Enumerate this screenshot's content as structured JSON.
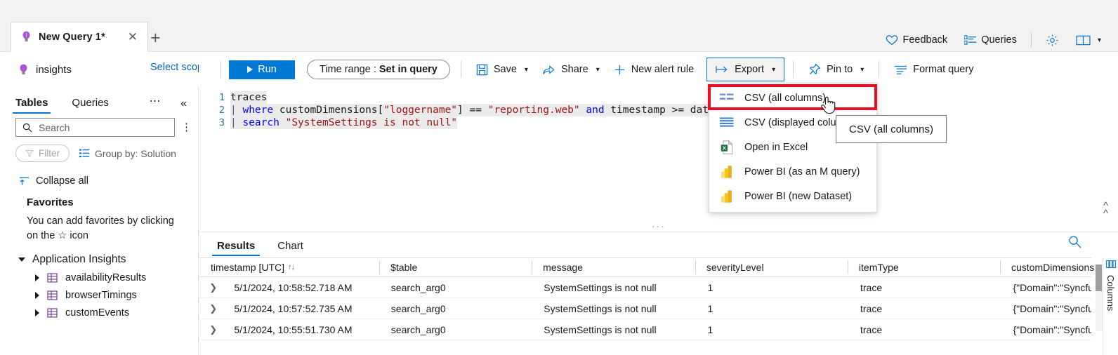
{
  "tab": {
    "label": "New Query 1*",
    "close_icon": "close-icon",
    "bulb_icon": "lightbulb-icon",
    "add_icon": "plus-icon"
  },
  "header_right": {
    "feedback": "Feedback",
    "queries": "Queries",
    "settings_icon": "gear-icon",
    "book_icon": "book-icon",
    "chevron_icon": "chevron-down-icon"
  },
  "scope": {
    "name": "insights",
    "select_link": "Select scope"
  },
  "toolbar": {
    "run": "Run",
    "time_range_label": "Time range :",
    "time_range_value": "Set in query",
    "save": "Save",
    "share": "Share",
    "new_alert_rule": "New alert rule",
    "export": "Export",
    "pin_to": "Pin to",
    "format_query": "Format query"
  },
  "export_menu": {
    "items": [
      {
        "label": "CSV (all columns)",
        "icon": "csv-all-columns-icon"
      },
      {
        "label": "CSV (displayed columns)",
        "icon": "csv-displayed-columns-icon"
      },
      {
        "label": "Open in Excel",
        "icon": "excel-icon"
      },
      {
        "label": "Power BI (as an M query)",
        "icon": "power-bi-icon"
      },
      {
        "label": "Power BI (new Dataset)",
        "icon": "power-bi-icon"
      }
    ],
    "tooltip": "CSV (all columns)",
    "highlight_color": "#e81123"
  },
  "sidebar": {
    "tabs": [
      {
        "label": "Tables",
        "active": true
      },
      {
        "label": "Queries",
        "active": false
      }
    ],
    "more_icon": "ellipsis-icon",
    "collapse_icon": "double-chevron-left-icon",
    "search_placeholder": "Search",
    "filter_label": "Filter",
    "group_by": "Group by: Solution",
    "collapse_all": "Collapse all",
    "favorites_title": "Favorites",
    "favorites_text": "You can add favorites by clicking on the ☆ icon",
    "group_title": "Application Insights",
    "tables": [
      "availabilityResults",
      "browserTimings",
      "customEvents"
    ]
  },
  "editor": {
    "lines": [
      {
        "num": "1",
        "parts": [
          {
            "t": "traces",
            "c": "op"
          }
        ]
      },
      {
        "num": "2",
        "parts": [
          {
            "t": "| ",
            "c": "pipe"
          },
          {
            "t": "where",
            "c": "kw"
          },
          {
            "t": " customDimensions[",
            "c": "op"
          },
          {
            "t": "\"loggername\"",
            "c": "str"
          },
          {
            "t": "] == ",
            "c": "op"
          },
          {
            "t": "\"reporting.web\"",
            "c": "str"
          },
          {
            "t": " ",
            "c": "op"
          },
          {
            "t": "and",
            "c": "kw"
          },
          {
            "t": " timestamp >= dat",
            "c": "op"
          }
        ]
      },
      {
        "num": "3",
        "parts": [
          {
            "t": "| ",
            "c": "pipe"
          },
          {
            "t": "search",
            "c": "kw"
          },
          {
            "t": " ",
            "c": "op"
          },
          {
            "t": "\"SystemSettings is not null\"",
            "c": "str"
          }
        ]
      }
    ],
    "collapse_icon": "double-chevron-up-icon",
    "splitter_dots": "···"
  },
  "results": {
    "tabs": [
      {
        "label": "Results",
        "active": true
      },
      {
        "label": "Chart",
        "active": false
      }
    ],
    "search_icon": "search-icon",
    "columns": [
      "timestamp [UTC]",
      "$table",
      "message",
      "severityLevel",
      "itemType",
      "customDimensions"
    ],
    "sort_indicator": "↑↓",
    "rows": [
      {
        "timestamp": "5/1/2024, 10:58:52.718 AM",
        "table": "search_arg0",
        "message": "SystemSettings is not null",
        "severityLevel": "1",
        "itemType": "trace",
        "customDimensions": "{\"Domain\":\"Syncfu"
      },
      {
        "timestamp": "5/1/2024, 10:57:52.735 AM",
        "table": "search_arg0",
        "message": "SystemSettings is not null",
        "severityLevel": "1",
        "itemType": "trace",
        "customDimensions": "{\"Domain\":\"Syncfu"
      },
      {
        "timestamp": "5/1/2024, 10:55:51.730 AM",
        "table": "search_arg0",
        "message": "SystemSettings is not null",
        "severityLevel": "1",
        "itemType": "trace",
        "customDimensions": "{\"Domain\":\"Syncfu"
      }
    ],
    "columns_panel_label": "Columns",
    "columns_panel_icon": "columns-icon"
  },
  "colors": {
    "accent": "#0078d4",
    "link": "#0067b8",
    "highlight": "#e81123",
    "excel_green": "#217346",
    "powerbi_yellow": "#f2c811"
  }
}
